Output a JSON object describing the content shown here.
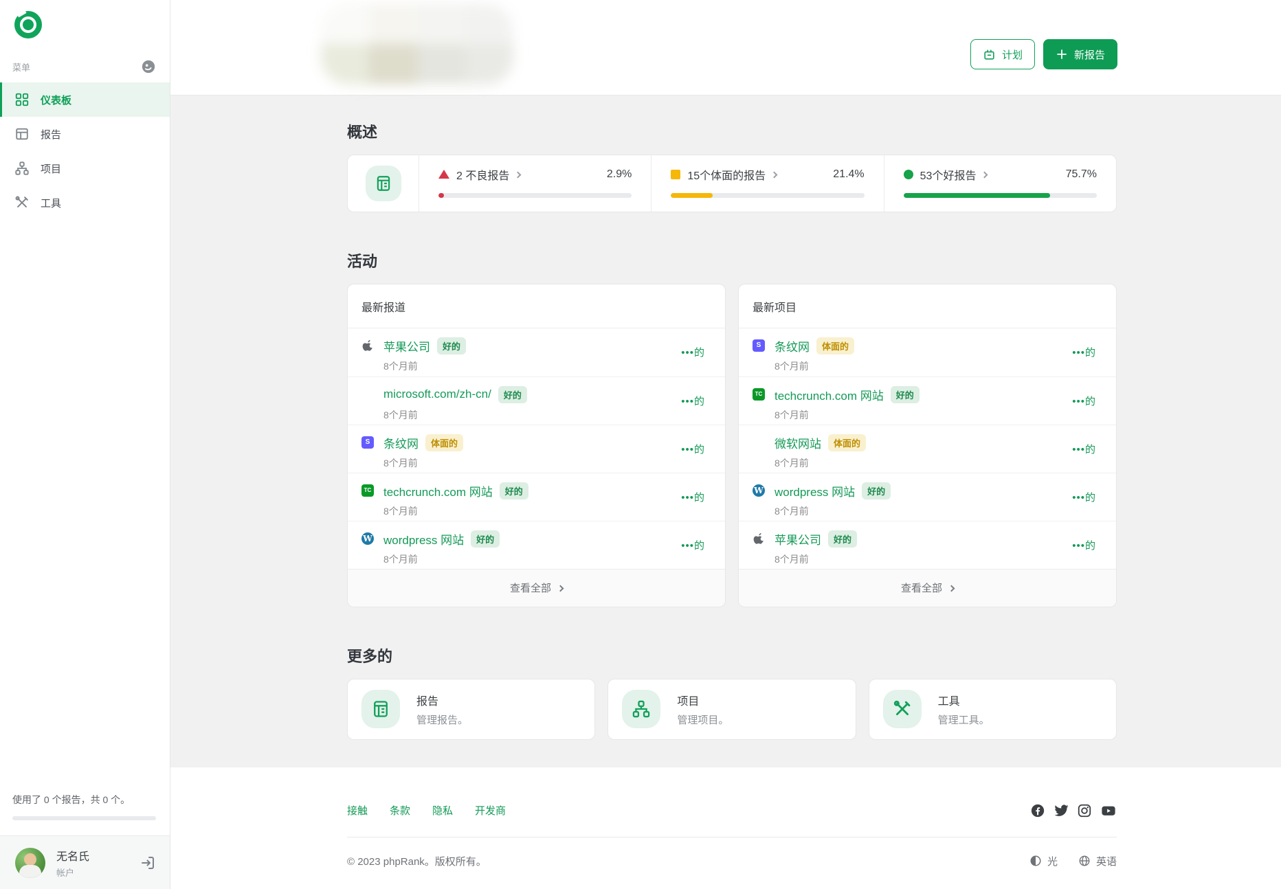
{
  "app": {
    "name": "phpRank",
    "accent_color": "#0f9f58"
  },
  "sidebar": {
    "menu_label": "菜单",
    "items": [
      {
        "label": "仪表板",
        "icon": "dashboard-icon",
        "active": true
      },
      {
        "label": "报告",
        "icon": "reports-icon",
        "active": false
      },
      {
        "label": "项目",
        "icon": "projects-icon",
        "active": false
      },
      {
        "label": "工具",
        "icon": "tools-icon",
        "active": false
      }
    ],
    "usage_text": "使用了 0 个报告，共 0 个。",
    "usage_percent": 0,
    "user": {
      "name": "无名氏",
      "role": "帐户"
    }
  },
  "header": {
    "plan_button": "计划",
    "new_report_button": "新报告"
  },
  "overview": {
    "title": "概述",
    "stats": [
      {
        "label": "2 不良报告",
        "percent_label": "2.9%",
        "percent": 2.9,
        "color": "#d63649",
        "shape": "triangle"
      },
      {
        "label": "15个体面的报告",
        "percent_label": "21.4%",
        "percent": 21.4,
        "color": "#f5b708",
        "shape": "square"
      },
      {
        "label": "53个好报告",
        "percent_label": "75.7%",
        "percent": 75.7,
        "color": "#16a34a",
        "shape": "circle"
      }
    ]
  },
  "activity": {
    "title": "活动",
    "view_all": "查看全部",
    "more_label": "•••的",
    "reports_card": {
      "title": "最新报道",
      "items": [
        {
          "site": "apple",
          "title": "苹果公司",
          "badge": "好的",
          "badge_variant": "good",
          "time": "8个月前"
        },
        {
          "site": "microsoft",
          "title": "microsoft.com/zh-cn/",
          "badge": "好的",
          "badge_variant": "good",
          "time": "8个月前"
        },
        {
          "site": "stripe",
          "title": "条纹网",
          "badge": "体面的",
          "badge_variant": "decent",
          "time": "8个月前"
        },
        {
          "site": "techcrunch",
          "title": "techcrunch.com 网站",
          "badge": "好的",
          "badge_variant": "good",
          "time": "8个月前"
        },
        {
          "site": "wordpress",
          "title": "wordpress 网站",
          "badge": "好的",
          "badge_variant": "good",
          "time": "8个月前"
        }
      ]
    },
    "projects_card": {
      "title": "最新项目",
      "items": [
        {
          "site": "stripe",
          "title": "条纹网",
          "badge": "体面的",
          "badge_variant": "decent",
          "time": "8个月前"
        },
        {
          "site": "techcrunch",
          "title": "techcrunch.com 网站",
          "badge": "好的",
          "badge_variant": "good",
          "time": "8个月前"
        },
        {
          "site": "microsoft",
          "title": "微软网站",
          "badge": "体面的",
          "badge_variant": "decent",
          "time": "8个月前"
        },
        {
          "site": "wordpress",
          "title": "wordpress 网站",
          "badge": "好的",
          "badge_variant": "good",
          "time": "8个月前"
        },
        {
          "site": "apple",
          "title": "苹果公司",
          "badge": "好的",
          "badge_variant": "good",
          "time": "8个月前"
        }
      ]
    }
  },
  "more": {
    "title": "更多的",
    "cards": [
      {
        "title": "报告",
        "subtitle": "管理报告。",
        "icon": "reports-icon"
      },
      {
        "title": "项目",
        "subtitle": "管理项目。",
        "icon": "projects-icon"
      },
      {
        "title": "工具",
        "subtitle": "管理工具。",
        "icon": "tools-icon"
      }
    ]
  },
  "footer": {
    "links": [
      "接触",
      "条款",
      "隐私",
      "开发商"
    ],
    "social_icons": [
      "facebook-icon",
      "twitter-icon",
      "instagram-icon",
      "youtube-icon"
    ],
    "copyright": "© 2023 phpRank。版权所有。",
    "theme_label": "光",
    "language_label": "英语"
  },
  "icon_letters": {
    "stripe": "S",
    "techcrunch": "TC",
    "wordpress": "W"
  },
  "status_colors": {
    "good": "#1d8a4e",
    "decent": "#bf8f00",
    "bad": "#d63649"
  }
}
